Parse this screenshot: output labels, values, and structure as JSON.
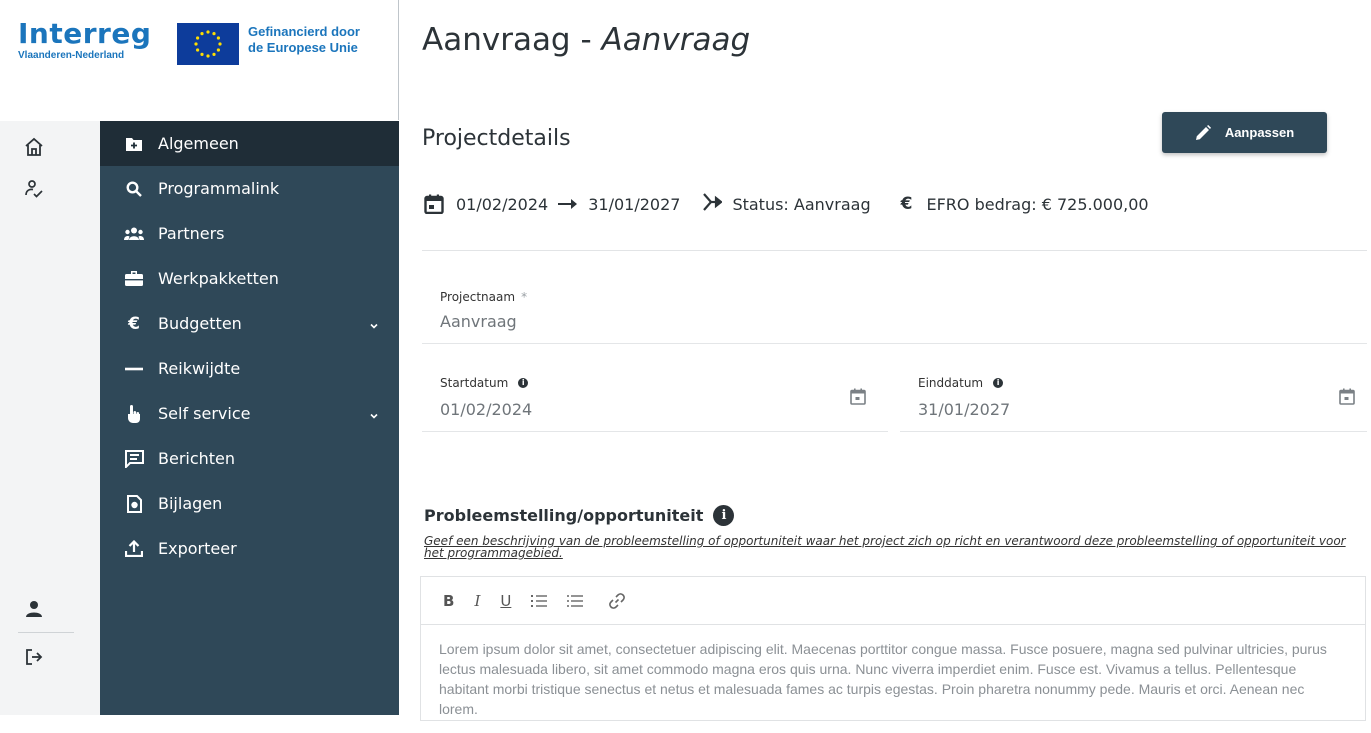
{
  "logo": {
    "interreg_word": "Interreg",
    "interreg_sub": "Vlaanderen-Nederland",
    "eu_line1": "Gefinancierd door",
    "eu_line2": "de Europese Unie"
  },
  "colors": {
    "sidebar": "#2f4858",
    "sidebar_active": "#1f2d37",
    "brand_blue": "#1b75bc",
    "button": "#2f4858"
  },
  "rail": {
    "items": [
      {
        "icon": "home-icon"
      },
      {
        "icon": "user-check-icon"
      },
      {
        "icon": "user-icon"
      },
      {
        "icon": "logout-icon"
      }
    ]
  },
  "sidebar": {
    "items": [
      {
        "label": "Algemeen",
        "icon": "folder-plus-icon",
        "active": true
      },
      {
        "label": "Programmalink",
        "icon": "search-icon"
      },
      {
        "label": "Partners",
        "icon": "users-icon"
      },
      {
        "label": "Werkpakketten",
        "icon": "briefcase-icon"
      },
      {
        "label": "Budgetten",
        "icon": "euro-icon",
        "expandable": true
      },
      {
        "label": "Reikwijdte",
        "icon": "minus-icon"
      },
      {
        "label": "Self service",
        "icon": "pointer-hand-icon",
        "expandable": true
      },
      {
        "label": "Berichten",
        "icon": "message-icon"
      },
      {
        "label": "Bijlagen",
        "icon": "document-icon"
      },
      {
        "label": "Exporteer",
        "icon": "upload-icon"
      }
    ]
  },
  "main": {
    "title_prefix": "Aanvraag - ",
    "title_italic": "Aanvraag",
    "section_title": "Projectdetails",
    "edit_button": "Aanpassen",
    "meta": {
      "start": "01/02/2024",
      "end": "31/01/2027",
      "status": "Status: Aanvraag",
      "budget": "EFRO bedrag: € 725.000,00"
    },
    "fields": {
      "projectnaam_label": "Projectnaam",
      "projectnaam_required": "*",
      "projectnaam_value": "Aanvraag",
      "startdatum_label": "Startdatum",
      "startdatum_value": "01/02/2024",
      "einddatum_label": "Einddatum",
      "einddatum_value": "31/01/2027"
    },
    "problem": {
      "title": "Probleemstelling/opportuniteit",
      "hint": "Geef een beschrijving van de probleemstelling of opportuniteit waar het project zich op richt en verantwoord deze probleemstelling of opportuniteit voor het programmagebied.",
      "toolbar": [
        "B",
        "I",
        "U"
      ],
      "body": "Lorem ipsum dolor sit amet, consectetuer adipiscing elit. Maecenas porttitor congue massa. Fusce posuere, magna sed pulvinar ultricies, purus lectus malesuada libero, sit amet commodo magna eros quis urna. Nunc viverra imperdiet enim. Fusce est. Vivamus a tellus. Pellentesque habitant morbi tristique senectus et netus et malesuada fames ac turpis egestas. Proin pharetra nonummy pede. Mauris et orci. Aenean nec lorem."
    }
  }
}
